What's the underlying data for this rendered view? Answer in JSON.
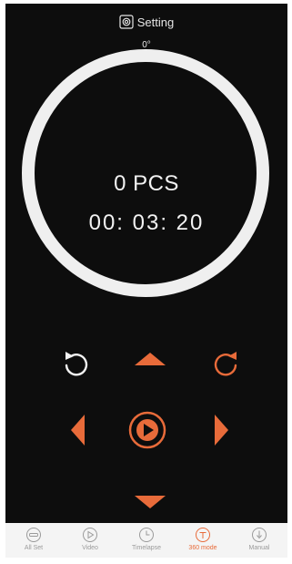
{
  "header": {
    "setting_label": "Setting",
    "setting_icon": "gear-icon",
    "angle": "0°"
  },
  "display": {
    "count": "0 PCS",
    "timer": "00: 03: 20"
  },
  "controls": {
    "rotate_left_icon": "rotate-ccw-icon",
    "rotate_right_icon": "rotate-cw-icon",
    "up_icon": "arrow-up-icon",
    "down_icon": "arrow-down-icon",
    "left_icon": "arrow-left-icon",
    "right_icon": "arrow-right-icon",
    "play_icon": "play-icon"
  },
  "tabs": [
    {
      "label": "All Set",
      "icon": "all-set-icon",
      "active": false
    },
    {
      "label": "Video",
      "icon": "video-play-icon",
      "active": false
    },
    {
      "label": "Timelapse",
      "icon": "clock-icon",
      "active": false
    },
    {
      "label": "360 mode",
      "icon": "360-mode-icon",
      "active": true
    },
    {
      "label": "Manual",
      "icon": "manual-icon",
      "active": false
    }
  ],
  "colors": {
    "background": "#0d0d0d",
    "accent": "#e86b3a",
    "ring": "#efefef",
    "text": "#f2f2f2",
    "tabbar": "#f4f4f4",
    "tab_inactive": "#9a9a9a"
  }
}
